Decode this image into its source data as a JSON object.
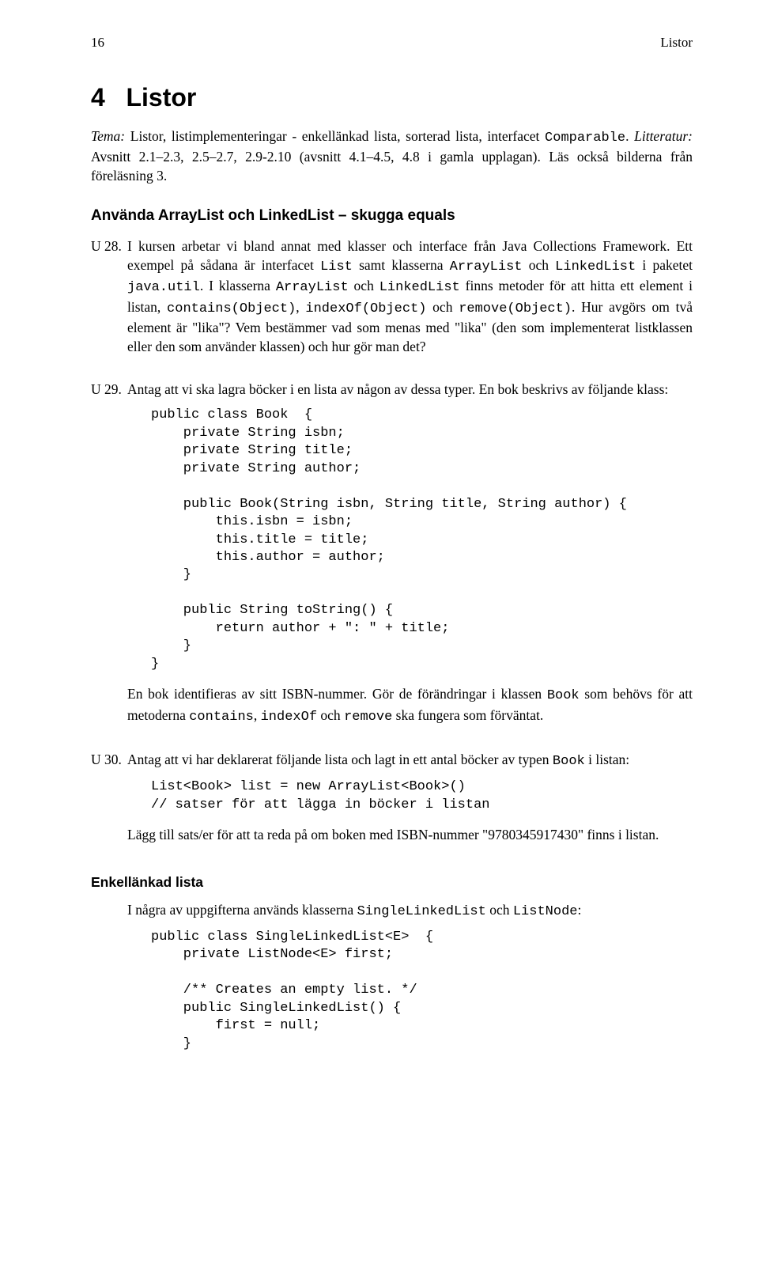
{
  "header": {
    "page_number": "16",
    "running_head": "Listor"
  },
  "chapter": {
    "number": "4",
    "title": "Listor"
  },
  "tema": {
    "label": "Tema:",
    "text": "Listor, listimplementeringar - enkellänkad lista, sorterad lista, interfacet ",
    "code1": "Comparable",
    "period": ".",
    "lit_label": "Litteratur:",
    "lit_text": " Avsnitt 2.1–2.3, 2.5–2.7, 2.9-2.10 (avsnitt 4.1–4.5, 4.8 i gamla upplagan). Läs också bilderna från föreläsning 3."
  },
  "section1": {
    "title": "Använda ArrayList och LinkedList – skugga equals"
  },
  "u28": {
    "label": "U 28.",
    "p1a": "I kursen arbetar vi bland annat med klasser och interface från Java Collections Framework. Ett exempel på sådana är interfacet ",
    "c1": "List",
    "p1b": " samt klasserna ",
    "c2": "ArrayList",
    "p1c": " och ",
    "c3": "LinkedList",
    "p1d": " i paketet ",
    "c4": "java.util",
    "p1e": ". I klasserna ",
    "c5": "ArrayList",
    "p1f": " och ",
    "c6": "LinkedList",
    "p1g": " finns metoder för att hitta ett element i listan, ",
    "c7": "contains(Object)",
    "p1h": ", ",
    "c8": "indexOf(Object)",
    "p1i": " och ",
    "c9": "remove(Object)",
    "p1j": ". Hur avgörs om två element är \"lika\"? Vem bestämmer vad som menas med \"lika\" (den som implementerat listklassen eller den som använder klassen) och hur gör man det?"
  },
  "u29": {
    "label": "U 29.",
    "p1": "Antag att vi ska lagra böcker i en lista av någon av dessa typer. En bok beskrivs av följande klass:",
    "code": "public class Book  {\n    private String isbn;\n    private String title;\n    private String author;\n\n    public Book(String isbn, String title, String author) {\n        this.isbn = isbn;\n        this.title = title;\n        this.author = author;\n    }\n\n    public String toString() {\n        return author + \": \" + title;\n    }\n}",
    "p2a": "En bok identifieras av sitt ISBN-nummer. Gör de förändringar i klassen ",
    "c1": "Book",
    "p2b": " som behövs för att metoderna ",
    "c2": "contains",
    "p2c": ", ",
    "c3": "indexOf",
    "p2d": " och ",
    "c4": "remove",
    "p2e": " ska fungera som förväntat."
  },
  "u30": {
    "label": "U 30.",
    "p1a": "Antag att vi har deklarerat följande lista och lagt in ett antal böcker av typen ",
    "c1": "Book",
    "p1b": " i listan:",
    "code": "List<Book> list = new ArrayList<Book>()\n// satser för att lägga in böcker i listan",
    "p2": "Lägg till sats/er för att ta reda på om boken med ISBN-nummer \"9780345917430\" finns i listan."
  },
  "section2": {
    "title": "Enkellänkad lista"
  },
  "sec2_intro": {
    "a": "I några av uppgifterna används klasserna ",
    "c1": "SingleLinkedList",
    "b": " och ",
    "c2": "ListNode",
    "c": ":"
  },
  "code_sll": "public class SingleLinkedList<E>  {\n    private ListNode<E> first;\n\n    /** Creates an empty list. */\n    public SingleLinkedList() {\n        first = null;\n    }"
}
